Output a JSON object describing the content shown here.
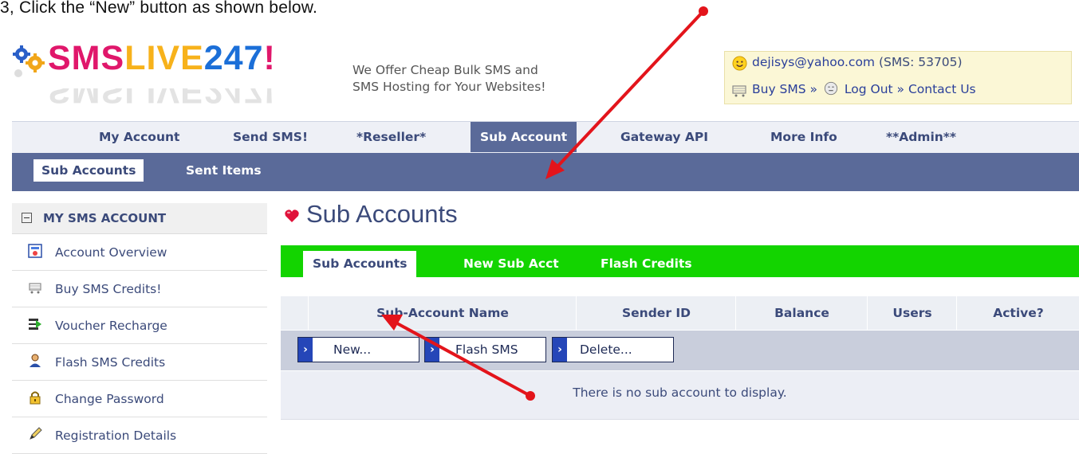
{
  "instruction": "3, Click the “New” button as shown below.",
  "brand": {
    "name_parts": [
      "SMS",
      "LIVE",
      "247",
      "!"
    ],
    "tagline": "We Offer Cheap Bulk SMS and\nSMS Hosting for Your Websites!",
    "colors": {
      "pink": "#e0176b",
      "orange": "#f7b21b",
      "blue": "#1b6fd8"
    }
  },
  "user": {
    "email": "dejisys@yahoo.com",
    "sms_label": "(SMS: 53705)",
    "links": {
      "buy_sms": "Buy SMS »",
      "log_out": "Log Out »",
      "contact": "Contact Us"
    }
  },
  "top_nav": [
    "My Account",
    "Send SMS!",
    "*Reseller*",
    "Sub Account",
    "Gateway API",
    "More Info",
    "**Admin**"
  ],
  "top_nav_active": "Sub Account",
  "sub_nav": [
    "Sub Accounts",
    "Sent Items"
  ],
  "sidebar": {
    "header": "MY SMS ACCOUNT",
    "items": [
      {
        "label": "Account Overview",
        "icon": "report-icon"
      },
      {
        "label": "Buy SMS Credits!",
        "icon": "cart-icon"
      },
      {
        "label": "Voucher Recharge",
        "icon": "recharge-icon"
      },
      {
        "label": "Flash SMS Credits",
        "icon": "user-icon"
      },
      {
        "label": "Change Password",
        "icon": "lock-icon"
      },
      {
        "label": "Registration Details",
        "icon": "pencil-icon"
      }
    ]
  },
  "main": {
    "title": "Sub Accounts",
    "tabs": [
      "Sub Accounts",
      "New Sub Acct",
      "Flash Credits"
    ],
    "columns": [
      "Sub-Account Name",
      "Sender ID",
      "Balance",
      "Users",
      "Active?"
    ],
    "buttons": [
      "New...",
      "Flash SMS",
      "Delete..."
    ],
    "empty_message": "There is no sub account to display."
  },
  "annotation_color": "#e3141b"
}
